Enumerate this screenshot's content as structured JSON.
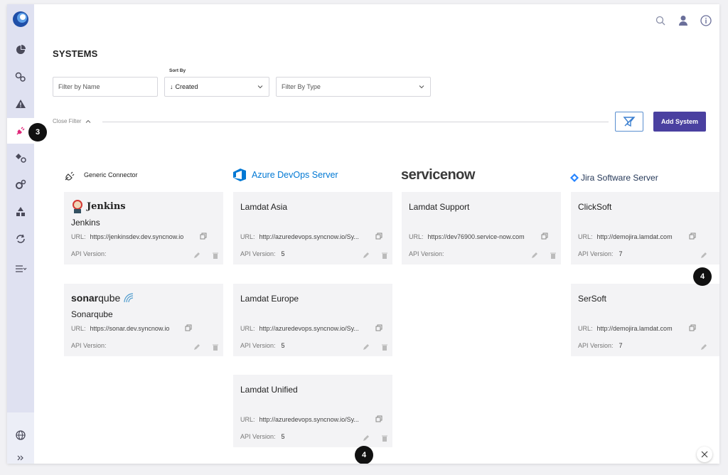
{
  "page": {
    "title": "SYSTEMS"
  },
  "filters": {
    "name_placeholder": "Filter by Name",
    "sort_label": "Sort By",
    "sort_value": "Created",
    "type_placeholder": "Filter By Type",
    "close_filter": "Close Filter",
    "add_system": "Add System"
  },
  "columns": [
    {
      "header": "Generic Connector"
    },
    {
      "header": "Azure DevOps Server"
    },
    {
      "header": "servicenow"
    },
    {
      "header": "Jira Software Server"
    }
  ],
  "cards": {
    "jenkins": {
      "logo": "Jenkins",
      "name": "Jenkins",
      "url_label": "URL:",
      "url": "https://jenkinsdev.dev.syncnow.io",
      "api_label": "API Version:",
      "api": ""
    },
    "sonar": {
      "logo_a": "sonar",
      "logo_b": "qube",
      "name": "Sonarqube",
      "url_label": "URL:",
      "url": "https://sonar.dev.syncnow.io",
      "api_label": "API Version:",
      "api": ""
    },
    "asia": {
      "name": "Lamdat Asia",
      "url_label": "URL:",
      "url": "http://azuredevops.syncnow.io/Sy...",
      "api_label": "API Version:",
      "api": "5"
    },
    "europe": {
      "name": "Lamdat Europe",
      "url_label": "URL:",
      "url": "http://azuredevops.syncnow.io/Sy...",
      "api_label": "API Version:",
      "api": "5"
    },
    "unified": {
      "name": "Lamdat Unified",
      "url_label": "URL:",
      "url": "http://azuredevops.syncnow.io/Sy...",
      "api_label": "API Version:",
      "api": "5"
    },
    "support": {
      "name": "Lamdat Support",
      "url_label": "URL:",
      "url": "https://dev76900.service-now.com",
      "api_label": "API Version:",
      "api": ""
    },
    "clicksoft": {
      "name": "ClickSoft",
      "url_label": "URL:",
      "url": "http://demojira.lamdat.com",
      "api_label": "API Version:",
      "api": "7"
    },
    "sersoft": {
      "name": "SerSoft",
      "url_label": "URL:",
      "url": "http://demojira.lamdat.com",
      "api_label": "API Version:",
      "api": "7"
    }
  },
  "badges": {
    "sidebar": "3",
    "clicksoft": "4",
    "unified": "4"
  },
  "colors": {
    "accent": "#4a40a0",
    "azure": "#0078d4",
    "sidebar": "#dfe1f1",
    "active_icon": "#e0287a"
  }
}
